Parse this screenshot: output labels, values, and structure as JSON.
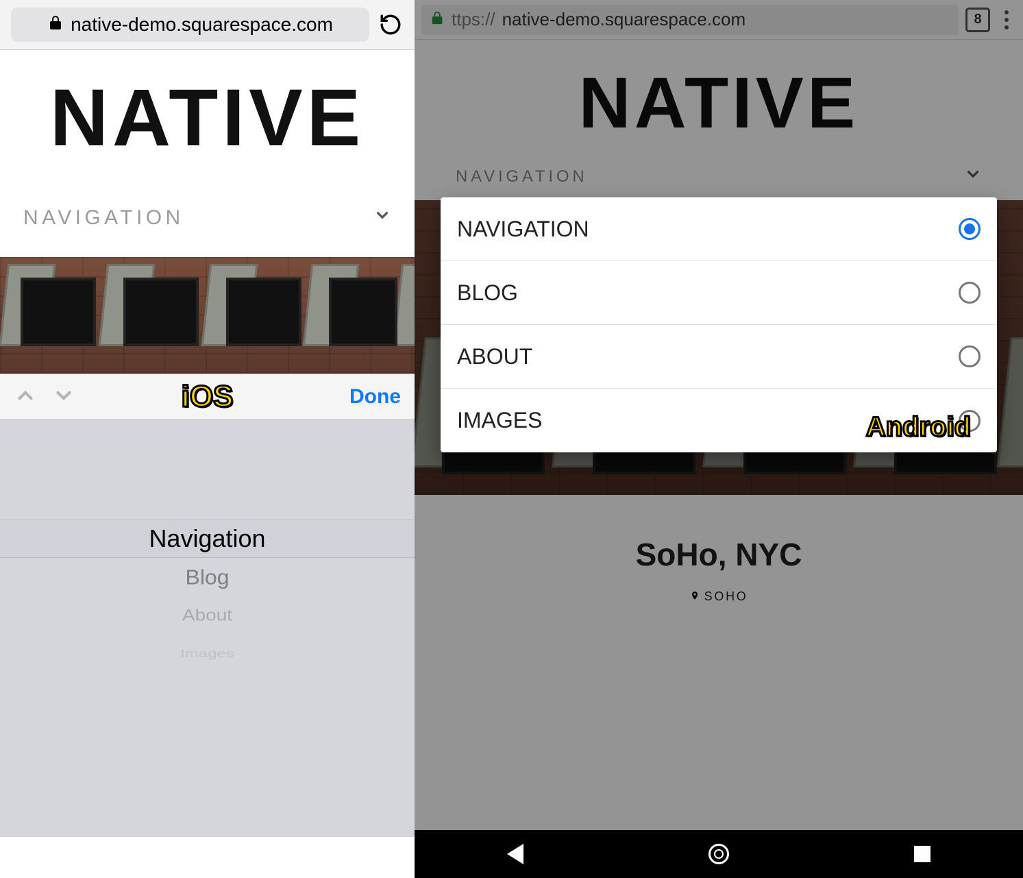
{
  "ios": {
    "url": "native-demo.squarespace.com",
    "logo": "NATIVE",
    "nav_label": "NAVIGATION",
    "picker_done": "Done",
    "overlay_label": "iOS",
    "picker_items": [
      "Navigation",
      "Blog",
      "About",
      "Images"
    ],
    "picker_selected_index": 0
  },
  "android": {
    "url_scheme": "ttps://",
    "url_host": "native-demo.squarespace.com",
    "tab_count": "8",
    "logo": "NATIVE",
    "nav_label": "NAVIGATION",
    "dropdown_items": [
      "NAVIGATION",
      "BLOG",
      "ABOUT",
      "IMAGES"
    ],
    "dropdown_selected_index": 0,
    "overlay_label": "Android",
    "soho_title": "SoHo, NYC",
    "soho_chip": "SOHO"
  }
}
